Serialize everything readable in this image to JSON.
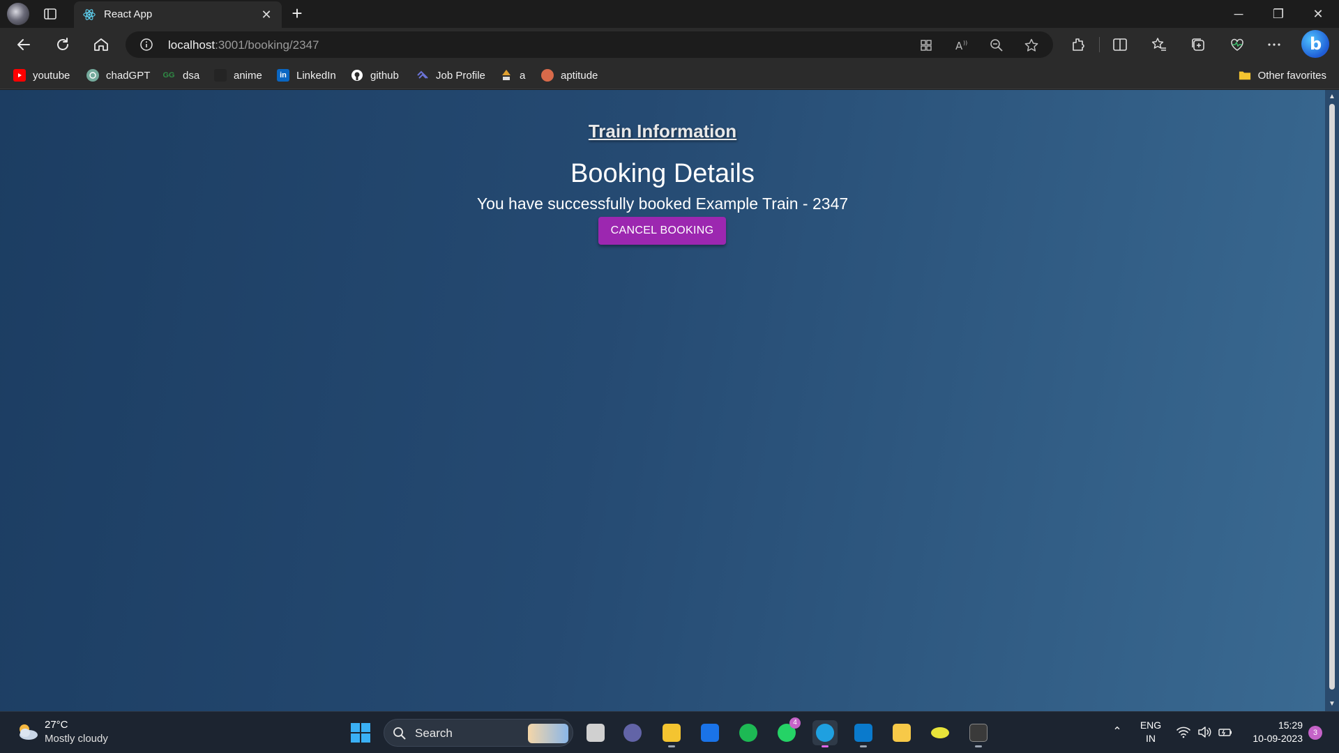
{
  "browser": {
    "tab": {
      "title": "React App",
      "close_glyph": "✕"
    },
    "new_tab_glyph": "+",
    "window_controls": {
      "minimize": "─",
      "restore": "❐",
      "close": "✕"
    },
    "address": {
      "host": "localhost",
      "path": ":3001/booking/2347"
    },
    "bookmarks": [
      {
        "label": "youtube",
        "icon": "youtube-icon",
        "color": "#ff0000"
      },
      {
        "label": "chadGPT",
        "icon": "chatgpt-icon",
        "color": "#74aa9c"
      },
      {
        "label": "dsa",
        "icon": "gfg-icon",
        "color": "#2f8d46"
      },
      {
        "label": "anime",
        "icon": "anime-icon",
        "color": "#2b2b2b"
      },
      {
        "label": "LinkedIn",
        "icon": "linkedin-icon",
        "color": "#0a66c2"
      },
      {
        "label": "github",
        "icon": "github-icon",
        "color": "#ffffff"
      },
      {
        "label": "Job Profile",
        "icon": "job-profile-icon",
        "color": "#6b73d6"
      },
      {
        "label": "a",
        "icon": "bookmark-a-icon",
        "color": "#e0a030"
      },
      {
        "label": "aptitude",
        "icon": "aptitude-icon",
        "color": "#d86a4a"
      }
    ],
    "other_favorites": "Other favorites"
  },
  "page": {
    "title": "Train Information",
    "heading": "Booking Details",
    "message": "You have successfully booked Example Train - 2347",
    "cancel_button": "CANCEL BOOKING",
    "accent_color": "#9c27b0"
  },
  "taskbar": {
    "weather": {
      "temp": "27°C",
      "desc": "Mostly cloudy"
    },
    "search_label": "Search",
    "apps": [
      {
        "name": "task-view-icon",
        "color": "#d0d0d0"
      },
      {
        "name": "teams-icon",
        "color": "#6264a7"
      },
      {
        "name": "file-explorer-icon",
        "color": "#f4c430"
      },
      {
        "name": "mail-icon",
        "color": "#1a73e8"
      },
      {
        "name": "spotify-icon",
        "color": "#1db954"
      },
      {
        "name": "whatsapp-icon",
        "color": "#25d366",
        "badge": "4"
      },
      {
        "name": "edge-icon",
        "color": "#1fa0e0"
      },
      {
        "name": "vscode-icon",
        "color": "#0a7acc"
      },
      {
        "name": "sticky-notes-icon",
        "color": "#f7c948"
      },
      {
        "name": "lemon-app-icon",
        "color": "#e8e43a"
      },
      {
        "name": "terminal-icon",
        "color": "#3a3a3a"
      }
    ],
    "lang": {
      "line1": "ENG",
      "line2": "IN"
    },
    "clock": {
      "time": "15:29",
      "date": "10-09-2023"
    },
    "notifications": "3"
  }
}
